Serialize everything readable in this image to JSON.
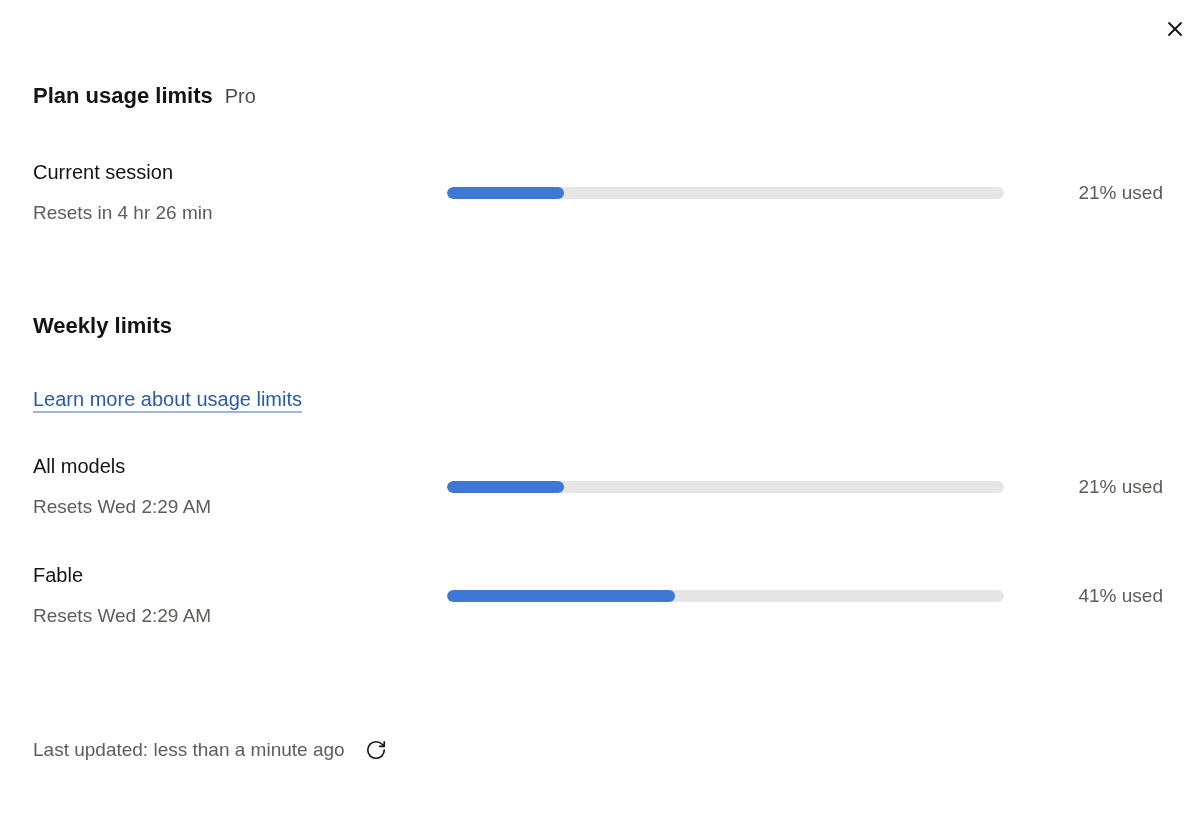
{
  "header": {
    "title": "Plan usage limits",
    "plan": "Pro"
  },
  "current_session": {
    "name": "Current session",
    "reset": "Resets in 4 hr 26 min",
    "level": 0.21,
    "reading": "21% used"
  },
  "weekly": {
    "title": "Weekly limits",
    "link": "Learn more about usage limits",
    "limits": [
      {
        "name": "All models",
        "reset": "Resets Wed 2:29 AM",
        "level": 0.21,
        "reading": "21% used"
      },
      {
        "name": "Fable",
        "reset": "Resets Wed 2:29 AM",
        "level": 0.41,
        "reading": "41% used"
      }
    ]
  },
  "footer": {
    "last_updated": "Last updated: less than a minute ago"
  }
}
